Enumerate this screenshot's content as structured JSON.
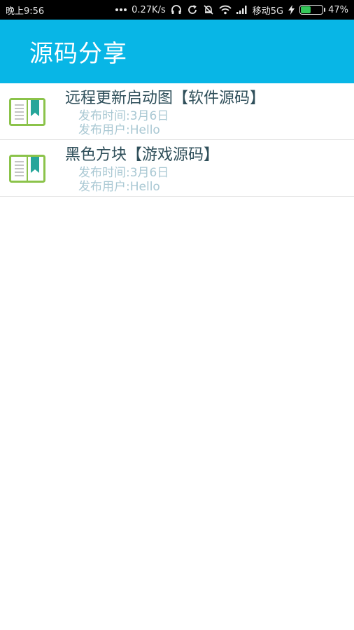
{
  "status_bar": {
    "time": "晚上9:56",
    "speed": "0.27K/s",
    "carrier": "移动5G",
    "battery_percent": "47%",
    "battery_level": 0.47
  },
  "app_bar": {
    "title": "源码分享"
  },
  "list": [
    {
      "title": "远程更新启动图【软件源码】",
      "date": "发布时间:3月6日",
      "user": "发布用户:Hello",
      "icon": "book-icon"
    },
    {
      "title": "黑色方块【游戏源码】",
      "date": "发布时间:3月6日",
      "user": "发布用户:Hello",
      "icon": "book-icon"
    }
  ],
  "colors": {
    "accent": "#08b6e6",
    "icon_green": "#8bc34a",
    "icon_teal": "#26a69a"
  }
}
